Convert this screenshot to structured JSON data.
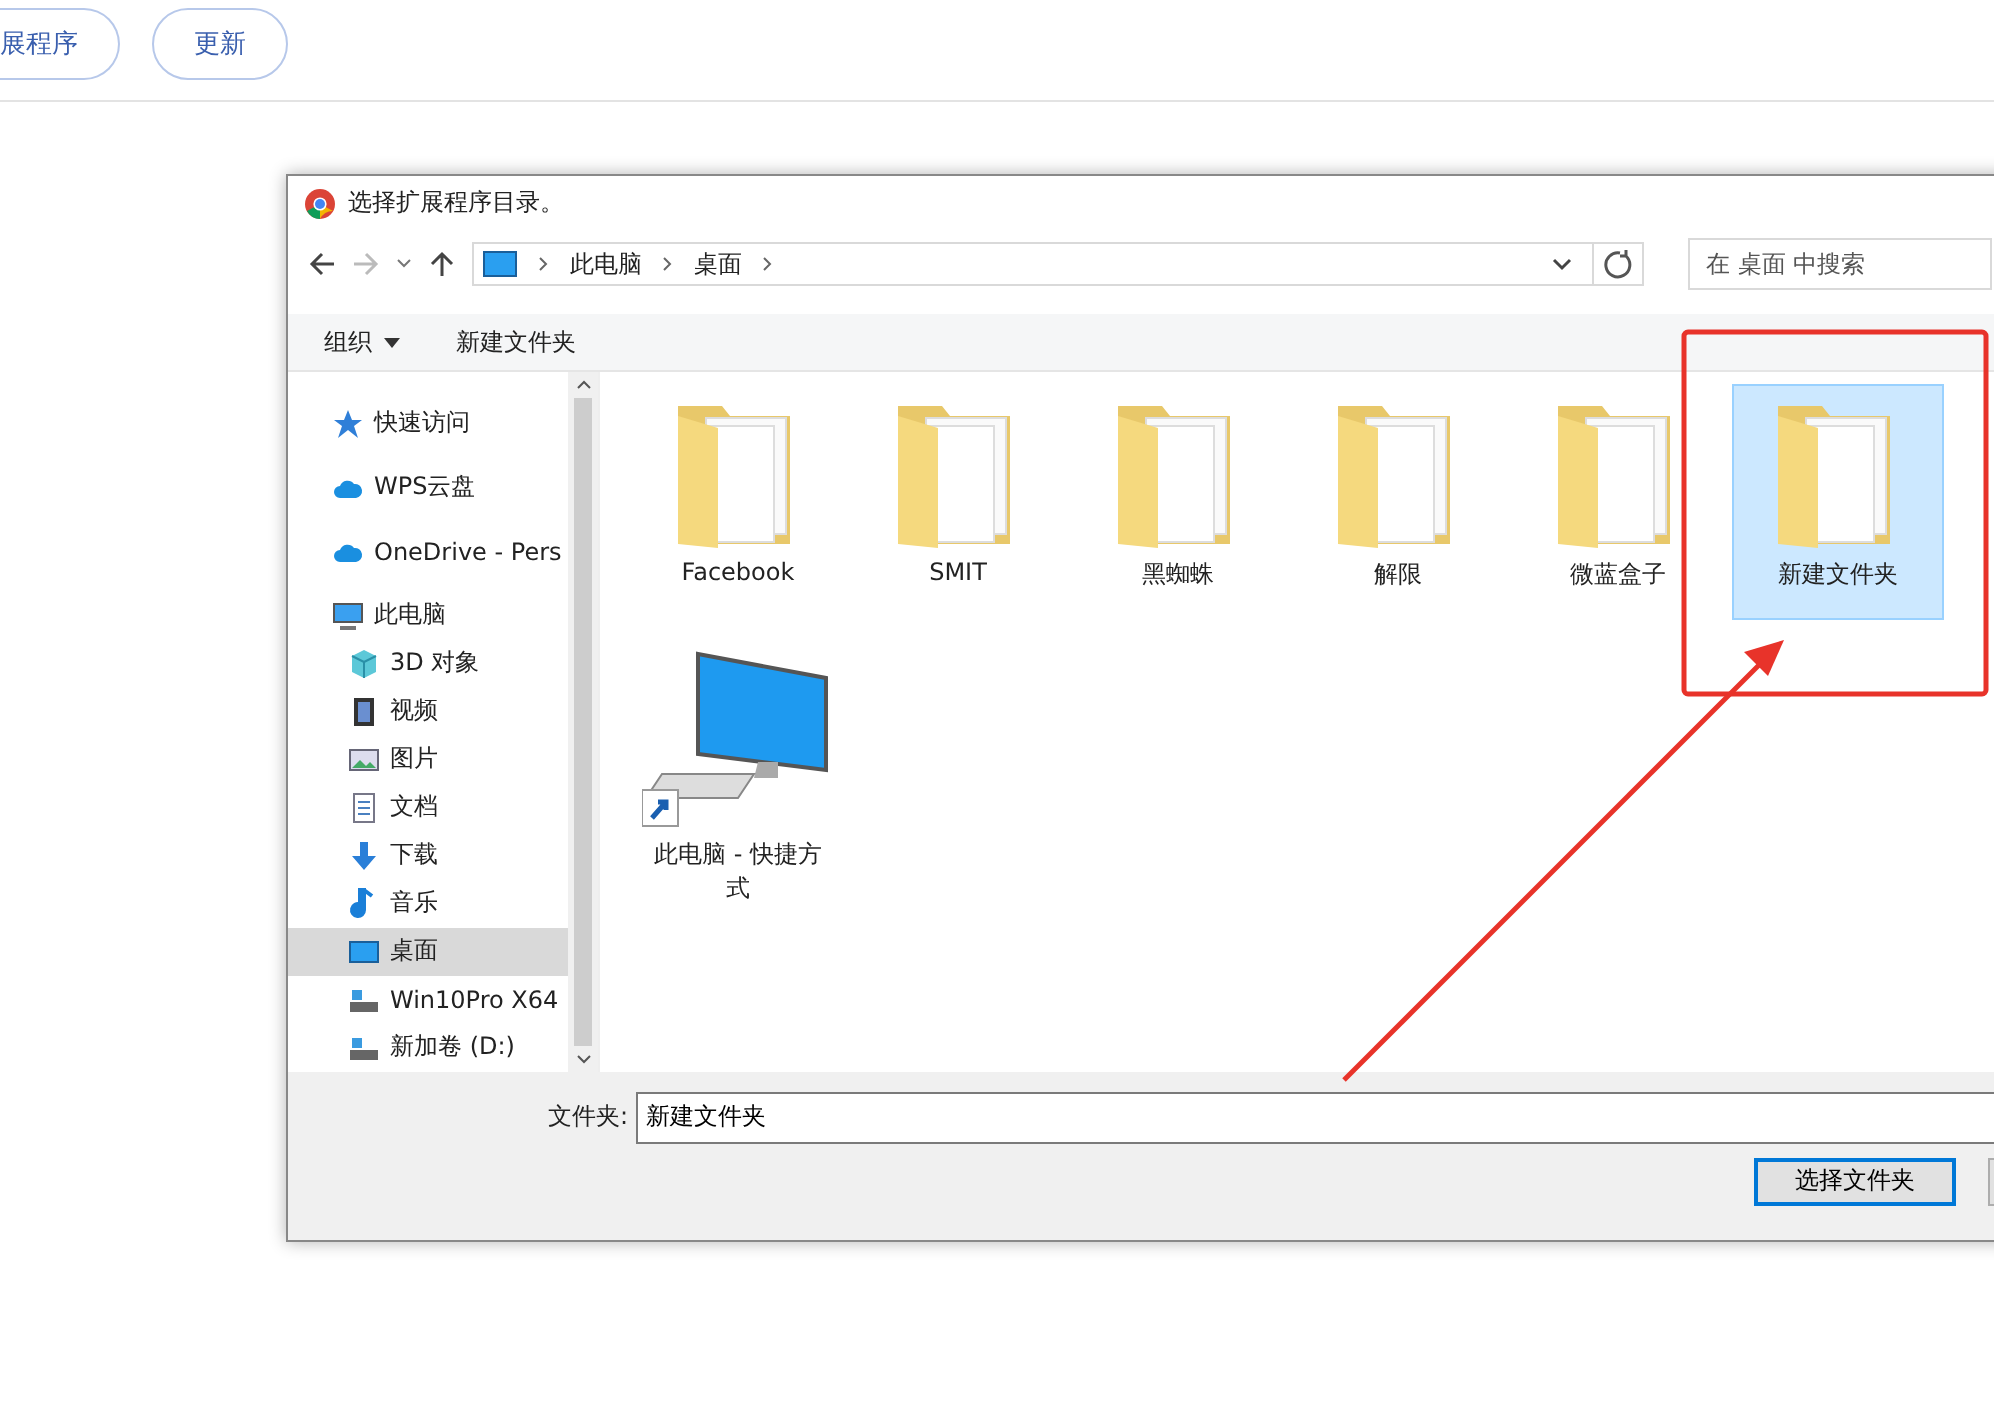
{
  "top_buttons": [
    "展程序",
    "更新"
  ],
  "dialog": {
    "title": "选择扩展程序目录。",
    "breadcrumb": [
      "此电脑",
      "桌面"
    ],
    "search": {
      "placeholder": "在 桌面 中搜索"
    },
    "toolbar": [
      {
        "label": "组织",
        "kind": "menu"
      },
      {
        "label": "新建文件夹",
        "kind": "button"
      }
    ],
    "sidebar": [
      {
        "label": "快速访问",
        "kind": "star",
        "selected": false
      },
      {
        "label": "WPS云盘",
        "kind": "cloud",
        "selected": false
      },
      {
        "label": "OneDrive - Pers",
        "kind": "cloud",
        "selected": false
      },
      {
        "label": "此电脑",
        "kind": "pc",
        "selected": false,
        "children": [
          {
            "label": "3D 对象",
            "kind": "cube",
            "selected": false
          },
          {
            "label": "视频",
            "kind": "film",
            "selected": false
          },
          {
            "label": "图片",
            "kind": "picture",
            "selected": false
          },
          {
            "label": "文档",
            "kind": "doc",
            "selected": false
          },
          {
            "label": "下载",
            "kind": "download",
            "selected": false
          },
          {
            "label": "音乐",
            "kind": "music",
            "selected": false
          },
          {
            "label": "桌面",
            "kind": "desktop",
            "selected": true
          },
          {
            "label": "Win10Pro X64",
            "kind": "drive",
            "selected": false
          },
          {
            "label": "新加卷 (D:)",
            "kind": "drive",
            "selected": false
          }
        ]
      }
    ],
    "items": [
      {
        "label": "Facebook",
        "kind": "folder",
        "selected": false
      },
      {
        "label": "SMIT",
        "kind": "folder",
        "selected": false
      },
      {
        "label": "黑蜘蛛",
        "kind": "folder",
        "selected": false
      },
      {
        "label": "解限",
        "kind": "folder",
        "selected": false
      },
      {
        "label": "微蓝盒子",
        "kind": "folder",
        "selected": false
      },
      {
        "label": "新建文件夹",
        "kind": "folder",
        "selected": true
      },
      {
        "label": "此电脑 - 快捷方式",
        "kind": "shortcut",
        "selected": false
      }
    ],
    "folder_field": {
      "label": "文件夹:",
      "value": "新建文件夹"
    },
    "buttons": [
      "选择文件夹"
    ]
  }
}
